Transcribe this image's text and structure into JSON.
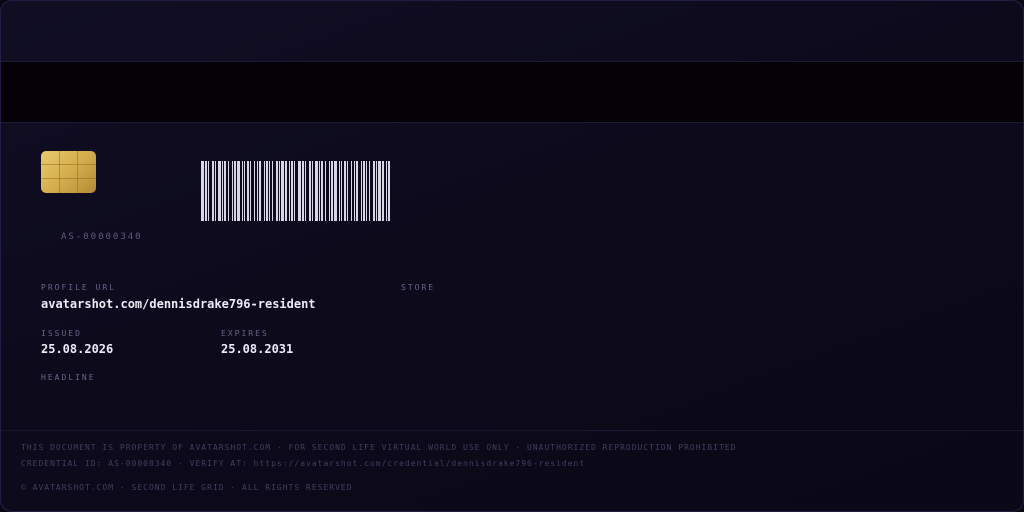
{
  "card": {
    "serial": "AS-00000340",
    "profile_url_label": "PROFILE URL",
    "profile_url": "avatarshot.com/dennisdrake796-resident",
    "store_label": "STORE",
    "issued_label": "ISSUED",
    "issued": "25.08.2026",
    "expires_label": "EXPIRES",
    "expires": "25.08.2031",
    "headline_label": "HEADLINE"
  },
  "footer": {
    "notice": "THIS DOCUMENT IS PROPERTY OF AVATARSHOT.COM · FOR SECOND LIFE VIRTUAL WORLD USE ONLY · UNAUTHORIZED REPRODUCTION PROHIBITED",
    "credential": "CREDENTIAL ID: AS-00000340 · VERIFY AT: https://avatarshot.com/credential/dennisdrake796-resident",
    "copyright": "© AVATARSHOT.COM · SECOND LIFE GRID · ALL RIGHTS RESERVED"
  },
  "colors": {
    "card_background": "#0d0a1c",
    "magnetic_stripe": "#040207",
    "chip_gold": "#d4ae4e",
    "barcode_bars": "#d8d6e4",
    "value_text": "#ecebf6",
    "label_text": "#6a6388"
  },
  "icons": {
    "chip": "emv-chip-icon",
    "barcode": "barcode-icon"
  }
}
